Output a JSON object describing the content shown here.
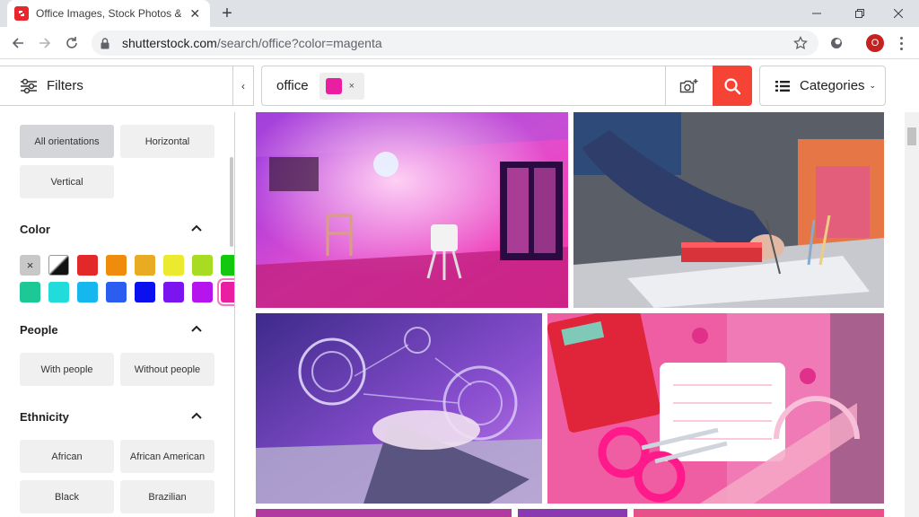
{
  "browser": {
    "tab_title": "Office Images, Stock Photos & Ve",
    "tab_close": "✕",
    "new_tab": "+",
    "url_host": "shutterstock.com",
    "url_path": "/search/office?color=magenta",
    "profile_initial": "O"
  },
  "header": {
    "filters_label": "Filters",
    "collapse_glyph": "‹",
    "search_query": "office",
    "color_chip": {
      "color": "#e91ea0",
      "remove_glyph": "×"
    },
    "categories_label": "Categories",
    "categories_caret": "⌄",
    "search_button_color": "#f54336"
  },
  "sidebar": {
    "orientations": [
      {
        "label": "All orientations",
        "active": true
      },
      {
        "label": "Horizontal",
        "active": false
      },
      {
        "label": "Vertical",
        "active": false
      }
    ],
    "color": {
      "title": "Color",
      "swatches": [
        {
          "name": "clear",
          "color": "#c8c8c8",
          "glyph": "×"
        },
        {
          "name": "black-white",
          "color": "#111111"
        },
        {
          "name": "red",
          "color": "#e3282a"
        },
        {
          "name": "orange",
          "color": "#f08c0c"
        },
        {
          "name": "amber",
          "color": "#e9ab21"
        },
        {
          "name": "yellow",
          "color": "#ecea2f"
        },
        {
          "name": "lime",
          "color": "#a7dc22"
        },
        {
          "name": "green",
          "color": "#13c910"
        },
        {
          "name": "teal",
          "color": "#1cc996"
        },
        {
          "name": "turquoise",
          "color": "#22dbdb"
        },
        {
          "name": "sky",
          "color": "#16b7ee"
        },
        {
          "name": "blue",
          "color": "#2a5df0"
        },
        {
          "name": "navy",
          "color": "#0b11ee"
        },
        {
          "name": "violet",
          "color": "#7b14ef"
        },
        {
          "name": "purple",
          "color": "#b514ef"
        },
        {
          "name": "magenta",
          "color": "#e91ea0",
          "selected": true
        }
      ]
    },
    "people": {
      "title": "People",
      "options": [
        "With people",
        "Without people"
      ]
    },
    "ethnicity": {
      "title": "Ethnicity",
      "options": [
        "African",
        "African American",
        "Black",
        "Brazilian"
      ]
    }
  }
}
